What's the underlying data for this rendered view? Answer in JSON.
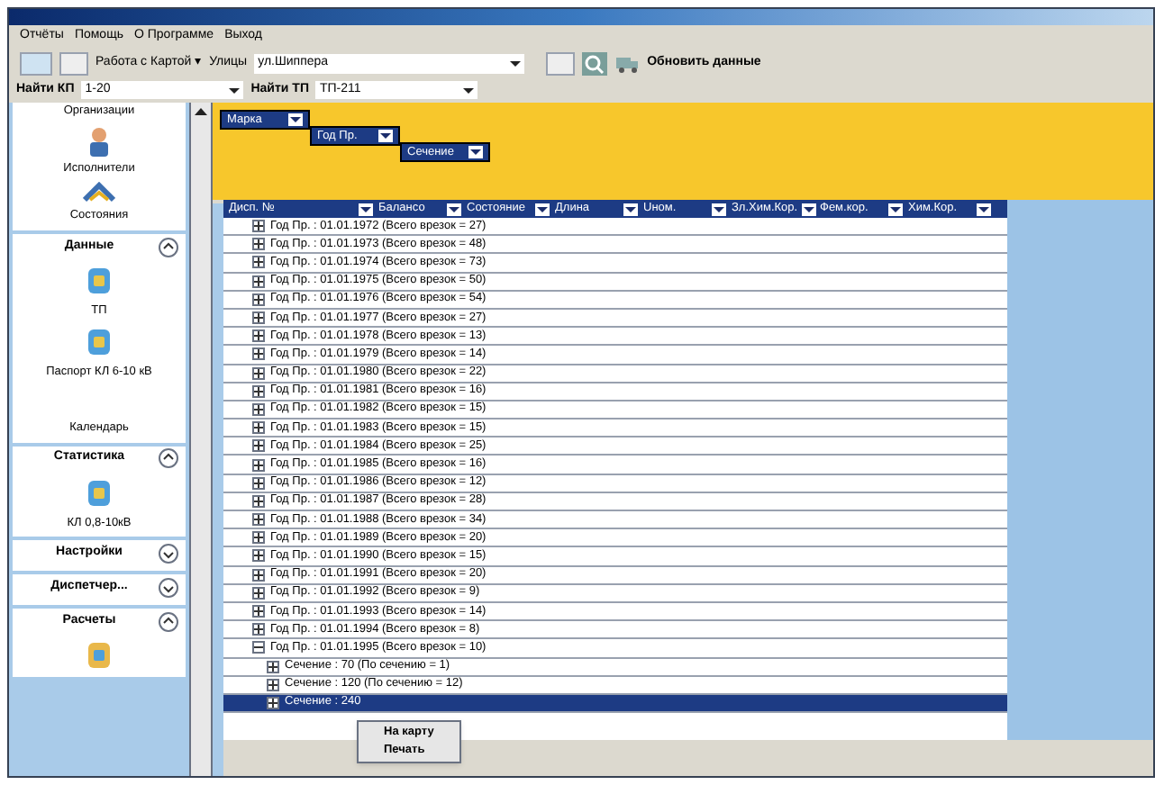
{
  "menu": [
    "Отчёты",
    "Помощь",
    "О Программе",
    "Выход"
  ],
  "toolbar": {
    "map_menu": "Работа с Картой ▾",
    "streets_label": "Улицы",
    "streets_value": "ул.Шиппера",
    "refresh": "Обновить данные"
  },
  "find_row": [
    {
      "label": "Найти КП",
      "value": "1-20"
    },
    {
      "label": "Найти ТП",
      "value": "ТП-211"
    }
  ],
  "sidebar": {
    "top_items": [
      "Организации",
      "Исполнители",
      "Состояния"
    ],
    "groups": [
      {
        "title": "Данные",
        "expanded": true,
        "items": [
          "ТП",
          "Паспорт КЛ 6-10 кВ",
          "Календарь"
        ]
      },
      {
        "title": "Статистика",
        "expanded": true,
        "items": [
          "КЛ 0,8-10кВ"
        ]
      },
      {
        "title": "Настройки",
        "expanded": false
      },
      {
        "title": "Диспетчер...",
        "expanded": false
      },
      {
        "title": "Расчеты",
        "expanded": true
      }
    ]
  },
  "group_chips": [
    "Марка",
    "Год Пр.",
    "Сечение"
  ],
  "table": {
    "columns": [
      "Дисп. №",
      "Балансо",
      "Состояние",
      "Длина",
      "Uном.",
      "Зл.Хим.Кор.",
      "Фем.кор.",
      "Хим.Кор."
    ],
    "rows": [
      {
        "text": "Год Пр. : 01.01.1972 (Всего врезок = 27)",
        "expanded": false,
        "children": []
      },
      {
        "text": "Год Пр. : 01.01.1973 (Всего врезок = 48)",
        "expanded": false,
        "children": []
      },
      {
        "text": "Год Пр. : 01.01.1974 (Всего врезок = 73)",
        "expanded": false,
        "children": []
      },
      {
        "text": "Год Пр. : 01.01.1975 (Всего врезок = 50)",
        "expanded": false,
        "children": []
      },
      {
        "text": "Год Пр. : 01.01.1976 (Всего врезок = 54)",
        "expanded": false,
        "children": []
      },
      {
        "text": "Год Пр. : 01.01.1977 (Всего врезок = 27)",
        "expanded": false,
        "children": []
      },
      {
        "text": "Год Пр. : 01.01.1978 (Всего врезок = 13)",
        "expanded": false,
        "children": []
      },
      {
        "text": "Год Пр. : 01.01.1979 (Всего врезок = 14)",
        "expanded": false,
        "children": []
      },
      {
        "text": "Год Пр. : 01.01.1980 (Всего врезок = 22)",
        "expanded": false,
        "children": []
      },
      {
        "text": "Год Пр. : 01.01.1981 (Всего врезок = 16)",
        "expanded": false,
        "children": []
      },
      {
        "text": "Год Пр. : 01.01.1982 (Всего врезок = 15)",
        "expanded": false,
        "children": []
      },
      {
        "text": "Год Пр. : 01.01.1983 (Всего врезок = 15)",
        "expanded": false,
        "children": []
      },
      {
        "text": "Год Пр. : 01.01.1984 (Всего врезок = 25)",
        "expanded": false,
        "children": []
      },
      {
        "text": "Год Пр. : 01.01.1985 (Всего врезок = 16)",
        "expanded": false,
        "children": []
      },
      {
        "text": "Год Пр. : 01.01.1986 (Всего врезок = 12)",
        "expanded": false,
        "children": []
      },
      {
        "text": "Год Пр. : 01.01.1987 (Всего врезок = 28)",
        "expanded": false,
        "children": []
      },
      {
        "text": "Год Пр. : 01.01.1988 (Всего врезок = 34)",
        "expanded": false,
        "children": []
      },
      {
        "text": "Год Пр. : 01.01.1989 (Всего врезок = 20)",
        "expanded": false,
        "children": []
      },
      {
        "text": "Год Пр. : 01.01.1990 (Всего врезок = 15)",
        "expanded": false,
        "children": []
      },
      {
        "text": "Год Пр. : 01.01.1991 (Всего врезок = 20)",
        "expanded": false,
        "children": []
      },
      {
        "text": "Год Пр. : 01.01.1992 (Всего врезок = 9)",
        "expanded": false,
        "children": []
      },
      {
        "text": "Год Пр. : 01.01.1993 (Всего врезок = 14)",
        "expanded": false,
        "children": []
      },
      {
        "text": "Год Пр. : 01.01.1994 (Всего врезок = 8)",
        "expanded": false,
        "children": []
      },
      {
        "text": "Год Пр. : 01.01.1995 (Всего врезок = 10)",
        "expanded": true,
        "children": [
          {
            "text": "Сечение : 70 (По сечению = 1)",
            "selected": false
          },
          {
            "text": "Сечение : 120 (По сечению = 12)",
            "selected": false
          },
          {
            "text": "Сечение : 240",
            "selected": true
          }
        ]
      }
    ]
  },
  "context_menu": [
    "На карту",
    "Печать"
  ]
}
